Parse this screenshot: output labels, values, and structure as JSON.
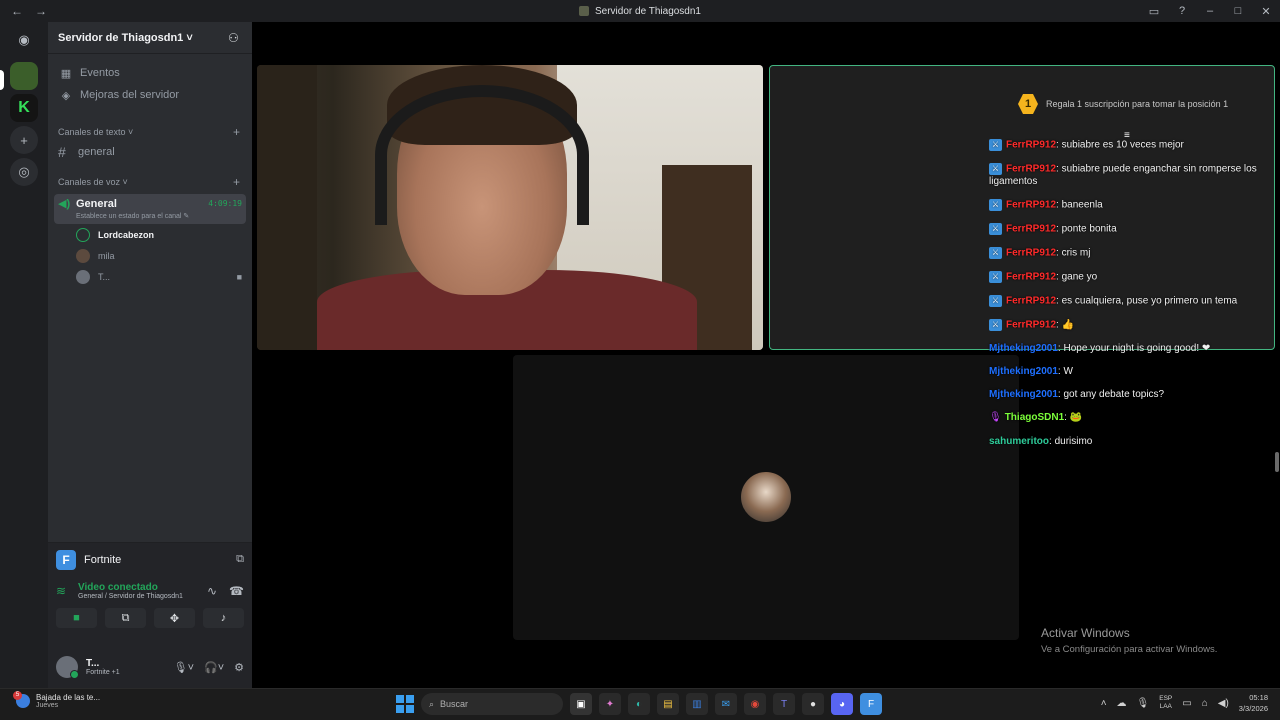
{
  "window": {
    "title": "Servidor de Thiagosdn1",
    "back": "←",
    "forward": "→"
  },
  "server": {
    "name": "Servidor de Thiagosdn1 ˅"
  },
  "sidebar": {
    "events": "Eventos",
    "boosts": "Mejoras del servidor",
    "text_category": "Canales de texto ˅",
    "text_channel": "general",
    "voice_category": "Canales de voz ˅",
    "voice_channel": "General",
    "voice_timer": "4:09:19",
    "voice_status": "Establece un estado para el canal ✎",
    "voice_users": [
      "Lordcabezon",
      "mila",
      "T..."
    ]
  },
  "activity": {
    "game": "Fortnite"
  },
  "voice_panel": {
    "status": "Video conectado",
    "location": "General / Servidor de Thiagosdn1"
  },
  "user_panel": {
    "name": "T...",
    "status": "Fortnite +1"
  },
  "stream": {
    "sub_number": "1",
    "sub_banner": "Regala 1 suscripción para tomar la posición 1"
  },
  "chat": [
    {
      "user": "FerrRP912",
      "text": ": subiabre es 10 veces mejor",
      "color": "#ff2a2a"
    },
    {
      "user": "FerrRP912",
      "text": ": subiabre puede enganchar sin romperse los ligamentos",
      "color": "#ff2a2a"
    },
    {
      "user": "FerrRP912",
      "text": ": baneenla",
      "color": "#ff2a2a"
    },
    {
      "user": "FerrRP912",
      "text": ": ponte bonita",
      "color": "#ff2a2a"
    },
    {
      "user": "FerrRP912",
      "text": ": cris mj",
      "color": "#ff2a2a"
    },
    {
      "user": "FerrRP912",
      "text": ": gane yo",
      "color": "#ff2a2a"
    },
    {
      "user": "FerrRP912",
      "text": ": es cualquiera, puse yo primero un tema",
      "color": "#ff2a2a"
    },
    {
      "user": "FerrRP912",
      "text": ": 👍",
      "color": "#ff2a2a"
    },
    {
      "user": "Mjtheking2001",
      "text": ": Hope your night is going good! ❤",
      "color": "#1e6fff"
    },
    {
      "user": "Mjtheking2001",
      "text": ": W",
      "color": "#1e6fff"
    },
    {
      "user": "Mjtheking2001",
      "text": ": got any debate topics?",
      "color": "#1e6fff"
    },
    {
      "user": "ThiagoSDN1",
      "text": ": 🐸",
      "color": "#7cff3a"
    },
    {
      "user": "sahumeritoo",
      "text": ": durisimo",
      "color": "#2ecc9a"
    }
  ],
  "watermark": {
    "line1": "Activar Windows",
    "line2": "Ve a Configuración para activar Windows."
  },
  "taskbar": {
    "notification_count": "5",
    "weather_line1": "Bajada de las te...",
    "weather_line2": "Jueves",
    "search_placeholder": "Buscar",
    "lang_line1": "ESP",
    "lang_line2": "LAA",
    "time": "05:18",
    "date": "3/3/2026"
  }
}
